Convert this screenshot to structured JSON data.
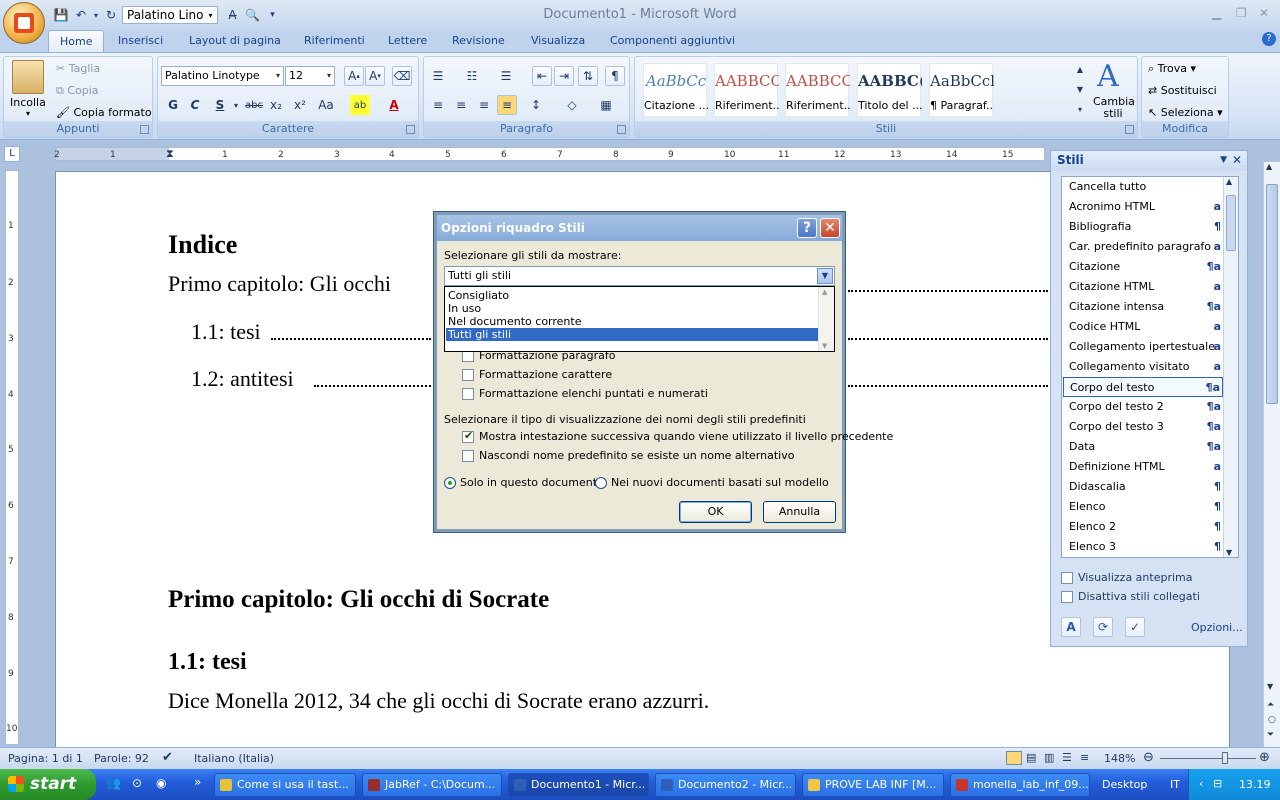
{
  "app": {
    "window_title": "Documento1 - Microsoft Word",
    "qat_font": "Palatino Lino"
  },
  "tabs": [
    "Home",
    "Inserisci",
    "Layout di pagina",
    "Riferimenti",
    "Lettere",
    "Revisione",
    "Visualizza",
    "Componenti aggiuntivi"
  ],
  "ribbon": {
    "clipboard": {
      "paste": "Incolla",
      "cut": "Taglia",
      "copy": "Copia",
      "format_painter": "Copia formato",
      "label": "Appunti"
    },
    "font": {
      "font_name": "Palatino Linotype",
      "font_size": "12",
      "bold": "G",
      "italic": "C",
      "underline": "S",
      "strikethrough": "abc",
      "subscript": "x₂",
      "superscript": "x²",
      "change_case": "Aa",
      "label": "Carattere"
    },
    "paragraph": {
      "label": "Paragrafo"
    },
    "styles": {
      "tiles": [
        {
          "sample": "AaBbCc",
          "name": "Citazione ..."
        },
        {
          "sample": "AABBCC",
          "name": "Riferiment..."
        },
        {
          "sample": "AABBCC",
          "name": "Riferiment..."
        },
        {
          "sample": "AABBC(",
          "name": "Titolo del ..."
        },
        {
          "sample": "AaBbCcl",
          "name": "¶ Paragraf..."
        }
      ],
      "change_styles": "Cambia stili",
      "label": "Stili"
    },
    "editing": {
      "find": "Trova",
      "replace": "Sostituisci",
      "select": "Seleziona",
      "label": "Modifica"
    }
  },
  "ruler": {
    "h_ticks": [
      "2",
      "1",
      "1",
      "2",
      "3",
      "4",
      "5",
      "6",
      "7",
      "8",
      "9",
      "10",
      "11",
      "12",
      "13",
      "14",
      "15"
    ],
    "v_ticks": [
      "1",
      "2",
      "3",
      "4",
      "5",
      "6",
      "7",
      "8",
      "9",
      "10"
    ]
  },
  "document": {
    "index_title": "Indice",
    "toc1": "Primo capitolo: Gli occhi",
    "toc2": "1.1: tesi",
    "toc3": "1.2: antitesi",
    "chapter_title": "Primo capitolo: Gli occhi di Socrate",
    "section_title": "1.1: tesi",
    "body_text": "Dice Monella 2012, 34 che gli occhi di Socrate erano azzurri."
  },
  "dialog": {
    "title": "Opzioni riquadro Stili",
    "select_label": "Selezionare gli stili da mostrare:",
    "combo_value": "Tutti gli stili",
    "options": [
      "Consigliato",
      "In uso",
      "Nel documento corrente",
      "Tutti gli stili"
    ],
    "selected_option": "Tutti gli stili",
    "checks": [
      {
        "label": "Formattazione paragrafo",
        "checked": false
      },
      {
        "label": "Formattazione carattere",
        "checked": false
      },
      {
        "label": "Formattazione elenchi puntati e numerati",
        "checked": false
      }
    ],
    "display_label": "Selezionare il tipo di visualizzazione dei nomi degli stili predefiniti",
    "display_checks": [
      {
        "label": "Mostra intestazione successiva quando viene utilizzato il livello precedente",
        "checked": true
      },
      {
        "label": "Nascondi nome predefinito se esiste un nome alternativo",
        "checked": false
      }
    ],
    "radio1": "Solo in questo documento",
    "radio2": "Nei nuovi documenti basati sul modello",
    "radio_selected": "Solo in questo documento",
    "ok": "OK",
    "cancel": "Annulla"
  },
  "styles_pane": {
    "title": "Stili",
    "items": [
      {
        "name": "Cancella tutto",
        "glyph": ""
      },
      {
        "name": "Acronimo HTML",
        "glyph": "a"
      },
      {
        "name": "Bibliografia",
        "glyph": "¶"
      },
      {
        "name": "Car. predefinito paragrafo",
        "glyph": "a"
      },
      {
        "name": "Citazione",
        "glyph": "¶a"
      },
      {
        "name": "Citazione HTML",
        "glyph": "a"
      },
      {
        "name": "Citazione intensa",
        "glyph": "¶a"
      },
      {
        "name": "Codice HTML",
        "glyph": "a"
      },
      {
        "name": "Collegamento ipertestuale",
        "glyph": "a"
      },
      {
        "name": "Collegamento visitato",
        "glyph": "a"
      },
      {
        "name": "Corpo del testo",
        "glyph": "¶a"
      },
      {
        "name": "Corpo del testo 2",
        "glyph": "¶a"
      },
      {
        "name": "Corpo del testo 3",
        "glyph": "¶a"
      },
      {
        "name": "Data",
        "glyph": "¶a"
      },
      {
        "name": "Definizione HTML",
        "glyph": "a"
      },
      {
        "name": "Didascalia",
        "glyph": "¶"
      },
      {
        "name": "Elenco",
        "glyph": "¶"
      },
      {
        "name": "Elenco 2",
        "glyph": "¶"
      },
      {
        "name": "Elenco 3",
        "glyph": "¶"
      }
    ],
    "selected": "Corpo del testo",
    "preview": "Visualizza anteprima",
    "disable_linked": "Disattiva stili collegati",
    "options": "Opzioni..."
  },
  "status": {
    "page": "Pagina: 1 di 1",
    "words": "Parole: 92",
    "language": "Italiano (Italia)",
    "zoom": "148%",
    "zoom_fraction": 0.68
  },
  "taskbar": {
    "start": "start",
    "tasks": [
      {
        "label": "Come si usa il tast...",
        "color": "#e8c13a"
      },
      {
        "label": "JabRef - C:\\Docum...",
        "color": "#9a2d2d"
      },
      {
        "label": "Documento1 - Micr...",
        "color": "#2f5fb8"
      },
      {
        "label": "Documento2 - Micr...",
        "color": "#2f5fb8"
      },
      {
        "label": "PROVE LAB INF [M...",
        "color": "#f0c649"
      },
      {
        "label": "monella_lab_inf_09...",
        "color": "#c8332b"
      }
    ],
    "active_task": "Documento1 - Micr...",
    "desktop": "Desktop",
    "lang": "IT",
    "time": "13.19"
  }
}
